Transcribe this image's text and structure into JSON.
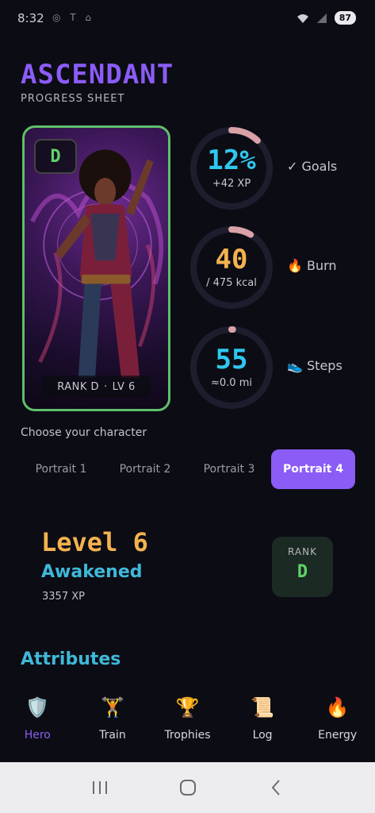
{
  "status": {
    "time": "8:32",
    "indicators": "◎ T ⌂",
    "battery": "87"
  },
  "app": {
    "title": "ASCENDANT",
    "subtitle": "PROGRESS SHEET"
  },
  "portrait": {
    "rank_badge": "D",
    "rank_label": "RANK D",
    "separator": "·",
    "level_label": "LV 6"
  },
  "metrics": [
    {
      "value": "12%",
      "sub": "+42 XP",
      "label": "✓ Goals",
      "color": "#2ec8ef",
      "progress": 0.12
    },
    {
      "value": "40",
      "sub": "/ 475 kcal",
      "label": "🔥 Burn",
      "color": "#f4b24f",
      "progress": 0.084
    },
    {
      "value": "55",
      "sub": "≈0.0 mi",
      "label": "👟 Steps",
      "color": "#2ec8ef",
      "progress": 0.006
    }
  ],
  "choose": {
    "label": "Choose your character"
  },
  "tabs": [
    {
      "label": "Portrait 1",
      "active": false
    },
    {
      "label": "Portrait 2",
      "active": false
    },
    {
      "label": "Portrait 3",
      "active": false
    },
    {
      "label": "Portrait 4",
      "active": true
    }
  ],
  "level": {
    "title": "Level 6",
    "name": "Awakened",
    "xp": "3357 XP",
    "rank_label": "RANK",
    "rank_value": "D"
  },
  "sections": {
    "attributes": "Attributes"
  },
  "nav": [
    {
      "label": "Hero",
      "icon": "shield-icon",
      "glyph": "🛡️",
      "active": true
    },
    {
      "label": "Train",
      "icon": "weightlifter-icon",
      "glyph": "🏋️",
      "active": false
    },
    {
      "label": "Trophies",
      "icon": "trophy-icon",
      "glyph": "🏆",
      "active": false
    },
    {
      "label": "Log",
      "icon": "scroll-icon",
      "glyph": "📜",
      "active": false
    },
    {
      "label": "Energy",
      "icon": "fire-icon",
      "glyph": "🔥",
      "active": false
    }
  ],
  "colors": {
    "accent": "#8b5cf6",
    "rank_green": "#5fd36a",
    "gold": "#f4b24f",
    "cyan": "#2ec8ef",
    "ring_track": "#1e1d2e",
    "ring_arc": "#d9a2a8"
  }
}
